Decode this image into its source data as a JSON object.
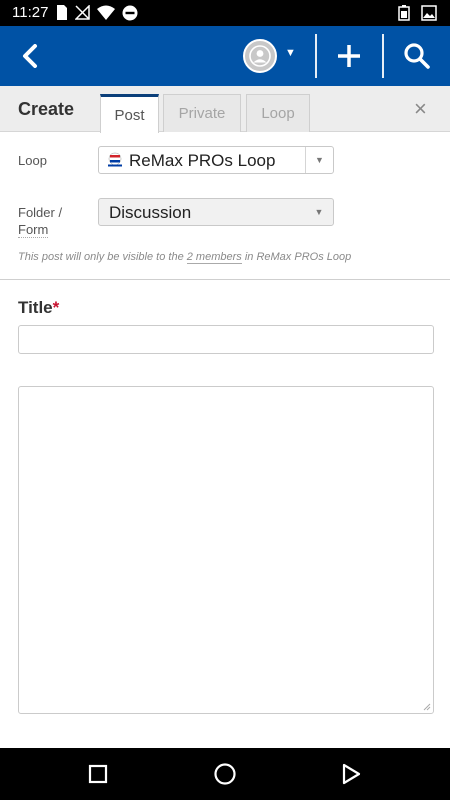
{
  "status_bar": {
    "time": "11:27",
    "icons": [
      "sim-card-icon",
      "no-signal-icon",
      "wifi-icon",
      "do-not-disturb-icon",
      "battery-icon",
      "image-icon"
    ]
  },
  "app_bar": {
    "color": "#0052a5",
    "icons": [
      "back-arrow-icon",
      "user-avatar-icon",
      "caret-down-icon",
      "plus-icon",
      "search-icon"
    ]
  },
  "create": {
    "title": "Create",
    "tabs": [
      {
        "label": "Post",
        "active": true
      },
      {
        "label": "Private",
        "active": false
      },
      {
        "label": "Loop",
        "active": false
      }
    ],
    "close_label": "×"
  },
  "form": {
    "loop_label": "Loop",
    "loop_value": "ReMax PROs Loop",
    "folder_label_1": "Folder /",
    "folder_label_2": "Form",
    "folder_value": "Discussion",
    "visibility_prefix": "This post will only be visible to the ",
    "visibility_link": "2 members",
    "visibility_suffix": " in ReMax PROs Loop",
    "title_label": "Title",
    "required_mark": "*",
    "title_value": "",
    "body_value": ""
  },
  "colors": {
    "accent": "#0052a5",
    "tab_active_border": "#0b3f7a",
    "required": "#c8102e"
  },
  "nav_bar": {
    "icons": [
      "recents-square-icon",
      "home-circle-icon",
      "back-triangle-icon"
    ]
  }
}
